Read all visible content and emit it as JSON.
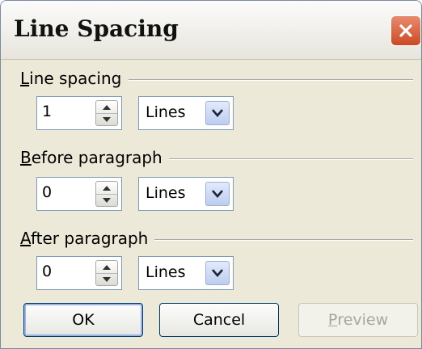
{
  "dialog": {
    "title": "Line Spacing"
  },
  "groups": [
    {
      "label_key": "L",
      "label_rest": "ine spacing",
      "value": "1",
      "unit": "Lines"
    },
    {
      "label_key": "B",
      "label_rest": "efore paragraph",
      "value": "0",
      "unit": "Lines"
    },
    {
      "label_key": "A",
      "label_rest": "fter paragraph",
      "value": "0",
      "unit": "Lines"
    }
  ],
  "buttons": {
    "ok": "OK",
    "cancel": "Cancel",
    "preview_key": "P",
    "preview_rest": "review"
  },
  "icons": {
    "close": "close-icon",
    "spin_up": "up-arrow-icon",
    "spin_down": "down-arrow-icon",
    "dropdown": "chevron-down-icon"
  },
  "colors": {
    "close_button": "#cc4a24",
    "dialog_bg": "#ece9d8",
    "dropdown_bg": "#bccdf1"
  }
}
